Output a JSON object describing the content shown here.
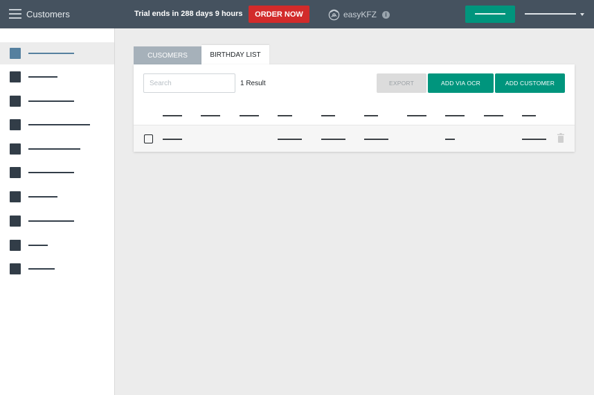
{
  "topbar": {
    "title": "Customers",
    "trial_text": "Trial ends in 288 days 9 hours",
    "order_button": "ORDER NOW",
    "brand_name": "easyKFZ",
    "info_icon": "i"
  },
  "colors": {
    "topbar": "#45525f",
    "accent_green": "#00957d",
    "order_red": "#d22b2b",
    "sidebar_active": "#55809f",
    "sidebar_icon": "#323d48"
  },
  "sidebar": {
    "items": [
      {
        "icon": "square-icon",
        "active": true
      },
      {
        "icon": "square-icon",
        "active": false
      },
      {
        "icon": "square-icon",
        "active": false
      },
      {
        "icon": "square-icon",
        "active": false
      },
      {
        "icon": "square-icon",
        "active": false
      },
      {
        "icon": "square-icon",
        "active": false
      },
      {
        "icon": "square-icon",
        "active": false
      },
      {
        "icon": "square-icon",
        "active": false
      },
      {
        "icon": "square-icon",
        "active": false
      },
      {
        "icon": "square-icon",
        "active": false
      }
    ]
  },
  "tabs": [
    {
      "label": "CUSOMERS",
      "active": false
    },
    {
      "label": "BIRTHDAY LIST",
      "active": true
    }
  ],
  "toolbar": {
    "search_placeholder": "Search",
    "result_count": "1 Result",
    "export_label": "EXPORT",
    "ocr_label": "ADD VIA OCR",
    "add_label": "ADD CUSTOMER"
  }
}
